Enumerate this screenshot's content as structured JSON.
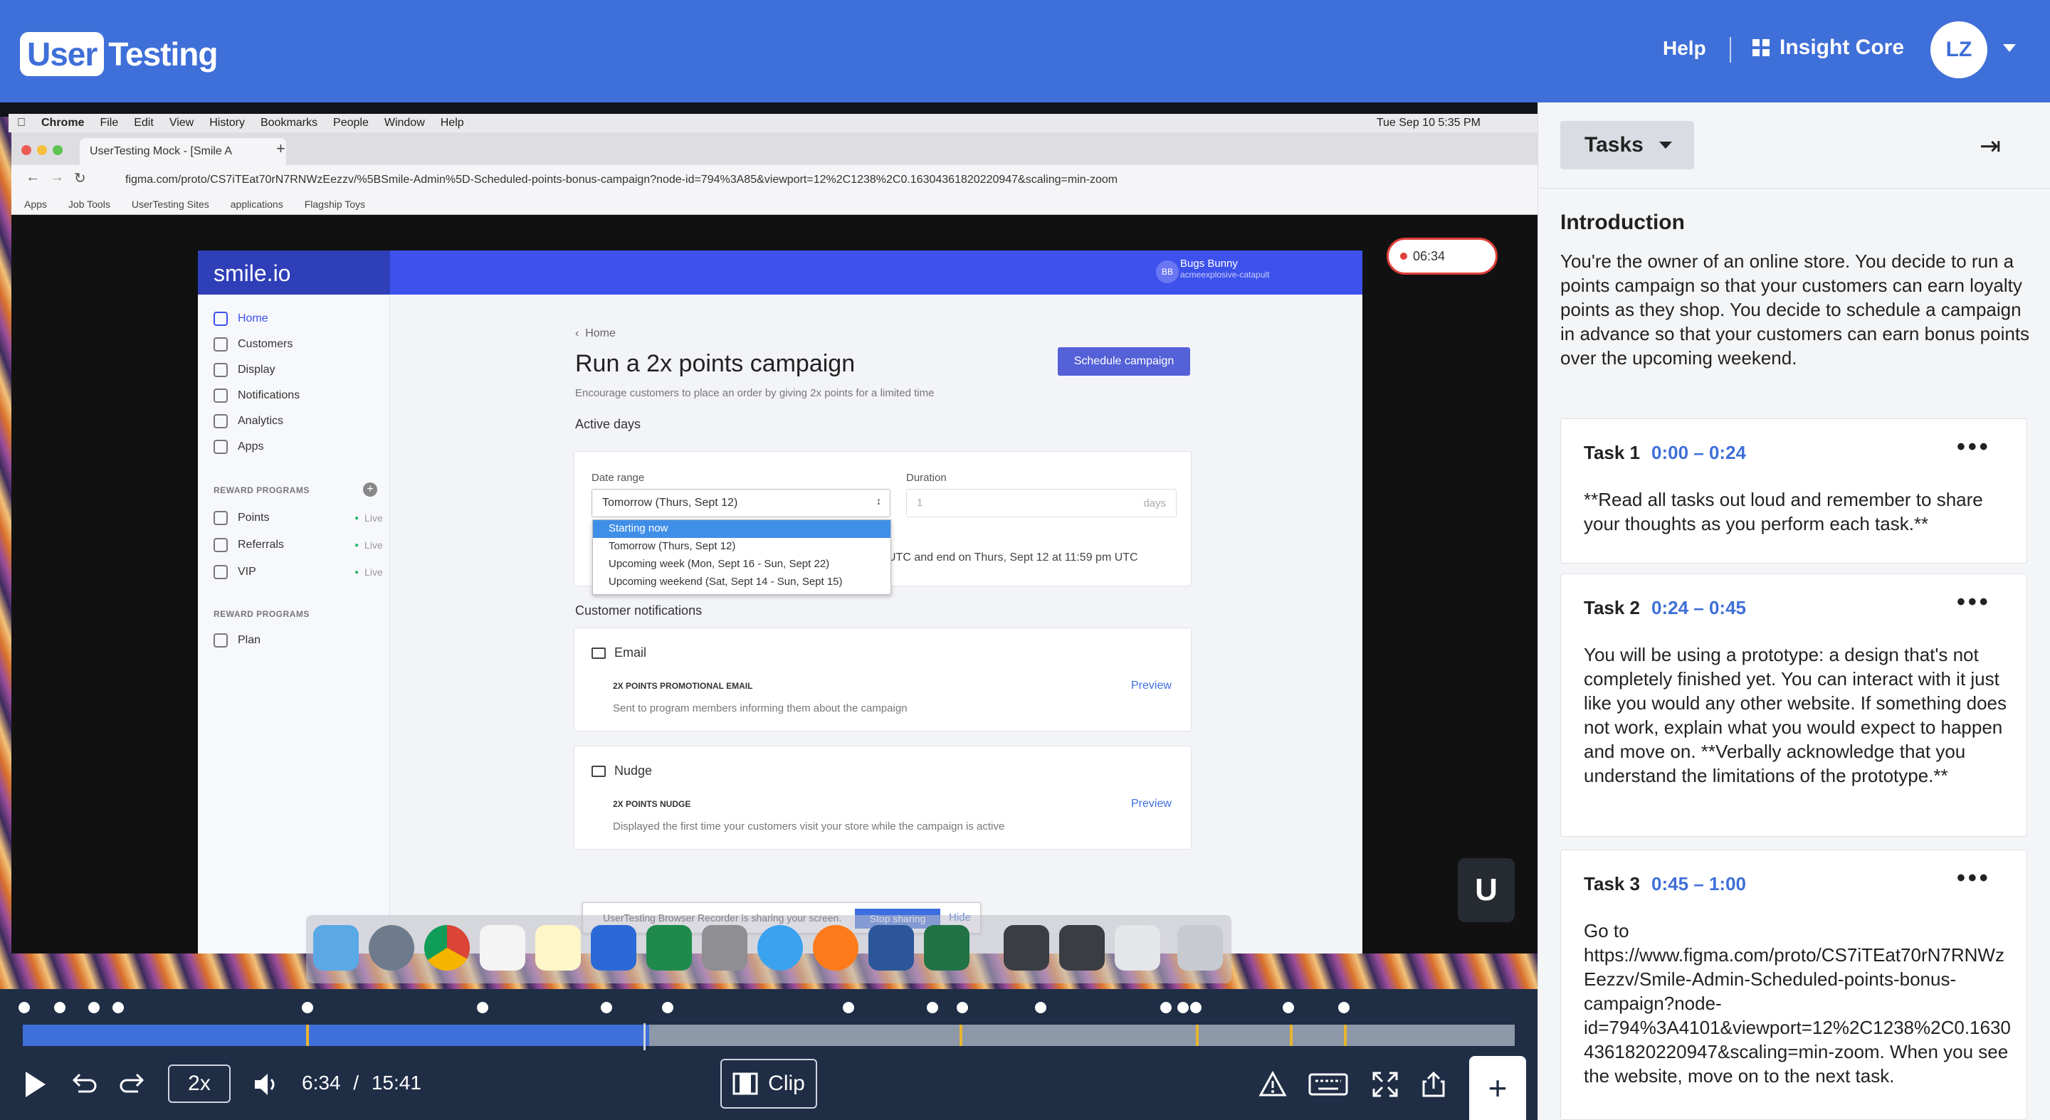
{
  "header": {
    "logo_user": "User",
    "logo_testing": "Testing",
    "help": "Help",
    "insight_core": "Insight Core",
    "avatar_initials": "LZ"
  },
  "video": {
    "mac_menu": [
      "Chrome",
      "File",
      "Edit",
      "View",
      "History",
      "Bookmarks",
      "People",
      "Window",
      "Help"
    ],
    "mac_clock": "Tue Sep 10  5:35 PM",
    "tab_title": "UserTesting Mock - [Smile A",
    "url": "figma.com/proto/CS7iTEat70rN7RNWzEezzv/%5BSmile-Admin%5D-Scheduled-points-bonus-campaign?node-id=794%3A85&viewport=12%2C1238%2C0.16304361820220947&scaling=min-zoom",
    "bookmarks": [
      "Apps",
      "Job Tools",
      "UserTesting Sites",
      "applications",
      "Flagship Toys"
    ],
    "recorder_time": "06:34"
  },
  "app": {
    "brand": "smile.io",
    "user_initials": "BB",
    "user_name": "Bugs Bunny",
    "user_store": "acmeexplosive-catapult",
    "nav": [
      "Home",
      "Customers",
      "Display",
      "Notifications",
      "Analytics",
      "Apps"
    ],
    "section_reward": "REWARD PROGRAMS",
    "programs": [
      "Points",
      "Referrals",
      "VIP"
    ],
    "live": "Live",
    "section_reward2": "REWARD PROGRAMS",
    "plan": "Plan",
    "breadcrumb": "Home",
    "title": "Run a 2x points campaign",
    "subtitle": "Encourage customers to place an order by giving 2x points for a limited time",
    "schedule_button": "Schedule campaign",
    "active_days": "Active days",
    "date_range_label": "Date range",
    "date_range_value": "Tomorrow (Thurs, Sept 12)",
    "duration_label": "Duration",
    "duration_value": "1",
    "duration_unit": "days",
    "utc_text": "UTC and end on Thurs, Sept 12 at 11:59 pm UTC",
    "dropdown_options": [
      "Starting now",
      "Tomorrow (Thurs, Sept 12)",
      "Upcoming week (Mon, Sept 16 - Sun, Sept 22)",
      "Upcoming weekend (Sat, Sept 14 - Sun, Sept 15)"
    ],
    "customer_notifications": "Customer notifications",
    "email_title": "Email",
    "email_name": "2X POINTS PROMOTIONAL EMAIL",
    "email_desc": "Sent to program members informing them about the campaign",
    "nudge_title": "Nudge",
    "nudge_name": "2X POINTS NUDGE",
    "nudge_desc": "Displayed the first time your customers visit your store while the campaign is active",
    "preview": "Preview",
    "share_text": "UserTesting Browser Recorder is sharing your screen.",
    "stop_sharing": "Stop sharing",
    "hide": "Hide"
  },
  "player": {
    "speed": "2x",
    "current_time": "6:34",
    "separator": "/",
    "total_time": "15:41",
    "clip": "Clip",
    "progress_fraction": 0.42
  },
  "panel": {
    "tasks_button": "Tasks",
    "intro_title": "Introduction",
    "intro_text": "You're the owner of an online store. You decide to run a points campaign so that your customers can earn loyalty points as they shop. You decide to schedule a campaign in advance so that your customers can earn bonus points over the upcoming weekend.",
    "tasks": [
      {
        "label": "Task 1",
        "time": "0:00 – 0:24",
        "body": "**Read all tasks out loud and remember to share your thoughts as you perform each task.**"
      },
      {
        "label": "Task 2",
        "time": "0:24 – 0:45",
        "body": "You will be using a prototype: a design that's not completely finished yet. You can interact with it just like you would any other website. If something does not work, explain what you would expect to happen and move on. **Verbally acknowledge that you understand the limitations of the prototype.**"
      },
      {
        "label": "Task 3",
        "time": "0:45 – 1:00",
        "body": "Go to https://www.figma.com/proto/CS7iTEat70rN7RNWzEezzv/Smile-Admin-Scheduled-points-bonus-campaign?node-id=794%3A4101&viewport=12%2C1238%2C0.16304361820220947&scaling=min-zoom. When you see the website, move on to the next task."
      }
    ]
  },
  "colors": {
    "brand_blue": "#3f6fd8",
    "player_bg": "#1f2d45",
    "marker_yellow": "#e8b530",
    "recording_red": "#e0403a"
  }
}
